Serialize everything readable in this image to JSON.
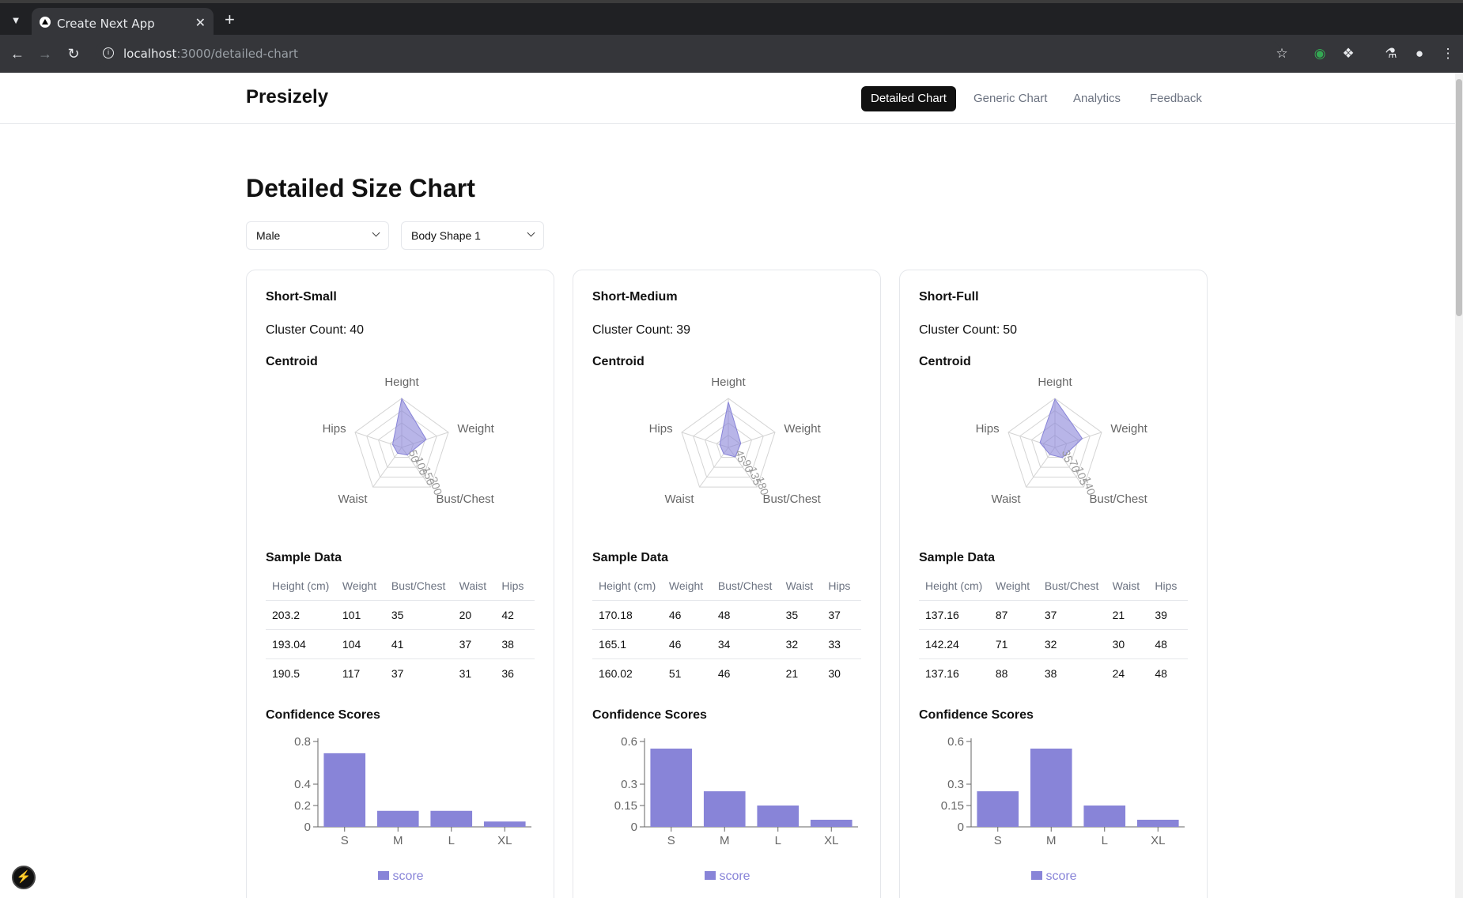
{
  "browser": {
    "tab_title": "Create Next App",
    "url_host": "localhost",
    "url_path": ":3000/detailed-chart"
  },
  "header": {
    "brand": "Presizely",
    "nav": [
      {
        "label": "Detailed Chart",
        "active": true
      },
      {
        "label": "Generic Chart",
        "active": false
      },
      {
        "label": "Analytics",
        "active": false
      },
      {
        "label": "Feedback",
        "active": false
      }
    ]
  },
  "main": {
    "title": "Detailed Size Chart",
    "filters": {
      "gender": "Male",
      "body_shape": "Body Shape 1"
    }
  },
  "labels": {
    "cluster_count": "Cluster Count:",
    "centroid": "Centroid",
    "sample_data": "Sample Data",
    "confidence_scores": "Confidence Scores",
    "legend": "score"
  },
  "table_headers": [
    "Height (cm)",
    "Weight",
    "Bust/Chest",
    "Waist",
    "Hips"
  ],
  "colors": {
    "accent": "#8884d8",
    "nav_active_bg": "#111111"
  },
  "cards": [
    {
      "title": "Short-Small",
      "cluster_count": "40",
      "rows": [
        [
          "203.2",
          "101",
          "35",
          "20",
          "42"
        ],
        [
          "193.04",
          "104",
          "41",
          "37",
          "38"
        ],
        [
          "190.5",
          "117",
          "37",
          "31",
          "36"
        ]
      ]
    },
    {
      "title": "Short-Medium",
      "cluster_count": "39",
      "rows": [
        [
          "170.18",
          "46",
          "48",
          "35",
          "37"
        ],
        [
          "165.1",
          "46",
          "34",
          "32",
          "33"
        ],
        [
          "160.02",
          "51",
          "46",
          "21",
          "30"
        ]
      ]
    },
    {
      "title": "Short-Full",
      "cluster_count": "50",
      "rows": [
        [
          "137.16",
          "87",
          "37",
          "21",
          "39"
        ],
        [
          "142.24",
          "71",
          "32",
          "30",
          "48"
        ],
        [
          "137.16",
          "88",
          "38",
          "24",
          "48"
        ]
      ]
    }
  ],
  "chart_data": [
    {
      "type": "radar",
      "axes": [
        "Height",
        "Weight",
        "Bust/Chest",
        "Waist",
        "Hips"
      ],
      "radial_ticks": [
        "50",
        "100",
        "150",
        "200"
      ],
      "rmax": 200,
      "values": [
        199,
        105,
        38,
        29,
        39
      ]
    },
    {
      "type": "bar",
      "categories": [
        "S",
        "M",
        "L",
        "XL"
      ],
      "values": [
        0.69,
        0.15,
        0.15,
        0.05
      ],
      "yticks": [
        "0",
        "0.2",
        "0.4",
        "0.8"
      ],
      "ylim": [
        0,
        0.8
      ],
      "legend": "score"
    },
    {
      "type": "radar",
      "axes": [
        "Height",
        "Weight",
        "Bust/Chest",
        "Waist",
        "Hips"
      ],
      "radial_ticks": [
        "45",
        "90",
        "135",
        "180"
      ],
      "rmax": 180,
      "values": [
        167,
        48,
        43,
        29,
        33
      ]
    },
    {
      "type": "bar",
      "categories": [
        "S",
        "M",
        "L",
        "XL"
      ],
      "values": [
        0.55,
        0.25,
        0.15,
        0.05
      ],
      "yticks": [
        "0",
        "0.15",
        "0.3",
        "0.6"
      ],
      "ylim": [
        0,
        0.6
      ],
      "legend": "score"
    },
    {
      "type": "radar",
      "axes": [
        "Height",
        "Weight",
        "Bust/Chest",
        "Waist",
        "Hips"
      ],
      "radial_ticks": [
        "35",
        "70",
        "105",
        "140"
      ],
      "rmax": 140,
      "values": [
        138,
        82,
        36,
        25,
        45
      ]
    },
    {
      "type": "bar",
      "categories": [
        "S",
        "M",
        "L",
        "XL"
      ],
      "values": [
        0.25,
        0.55,
        0.15,
        0.05
      ],
      "yticks": [
        "0",
        "0.15",
        "0.3",
        "0.6"
      ],
      "ylim": [
        0,
        0.6
      ],
      "legend": "score"
    }
  ]
}
